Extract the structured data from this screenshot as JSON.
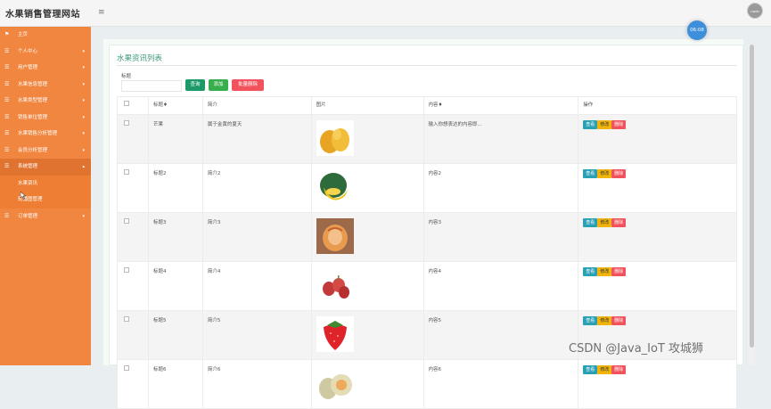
{
  "header": {
    "site_title": "水果销售管理网站",
    "menu_icon": "hamburger-icon",
    "avatar_text": "nwdn",
    "clock_time": "06:08"
  },
  "sidebar": {
    "items": [
      {
        "label": "主页",
        "icon": "flag-icon"
      },
      {
        "label": "个人中心",
        "icon": "list-icon"
      },
      {
        "label": "用户管理",
        "icon": "list-icon"
      },
      {
        "label": "水果信息管理",
        "icon": "list-icon"
      },
      {
        "label": "水果类型管理",
        "icon": "list-icon"
      },
      {
        "label": "销售单位管理",
        "icon": "list-icon"
      },
      {
        "label": "水果销售分析管理",
        "icon": "list-icon"
      },
      {
        "label": "会员分析管理",
        "icon": "list-icon"
      },
      {
        "label": "系统管理",
        "icon": "list-icon"
      },
      {
        "label": "订单管理",
        "icon": "list-icon"
      }
    ],
    "sub_items": [
      "水果资讯",
      "轮播图管理"
    ]
  },
  "panel": {
    "title": "水果资讯列表",
    "search_label": "标题",
    "search_value": "",
    "btn_query": "查询",
    "btn_add": "添加",
    "btn_batch_delete": "批量删除"
  },
  "table": {
    "headers": [
      "标题♦",
      "简介",
      "图片",
      "内容♦",
      "操作"
    ],
    "ops": {
      "view": "查看",
      "edit": "修改",
      "delete": "删除"
    },
    "rows": [
      {
        "title": "芒果",
        "intro": "属于金黄的夏天",
        "content": "输入你想表达的内容即...",
        "image": "mango"
      },
      {
        "title": "标题2",
        "intro": "简介2",
        "content": "内容2",
        "image": "melon-green"
      },
      {
        "title": "标题3",
        "intro": "简介3",
        "content": "内容3",
        "image": "carved-melon"
      },
      {
        "title": "标题4",
        "intro": "简介4",
        "content": "内容4",
        "image": "dates"
      },
      {
        "title": "标题5",
        "intro": "简介5",
        "content": "内容5",
        "image": "strawberry"
      },
      {
        "title": "标题6",
        "intro": "简介6",
        "content": "内容6",
        "image": "cantaloupe"
      }
    ]
  },
  "watermark": "CSDN @Java_IoT 攻城狮",
  "colors": {
    "sidebar": "#f0863f",
    "title_green": "#3e9a7a",
    "btn_query": "#1e9a6a",
    "btn_add": "#36ae4b",
    "btn_delete": "#f1525b"
  }
}
